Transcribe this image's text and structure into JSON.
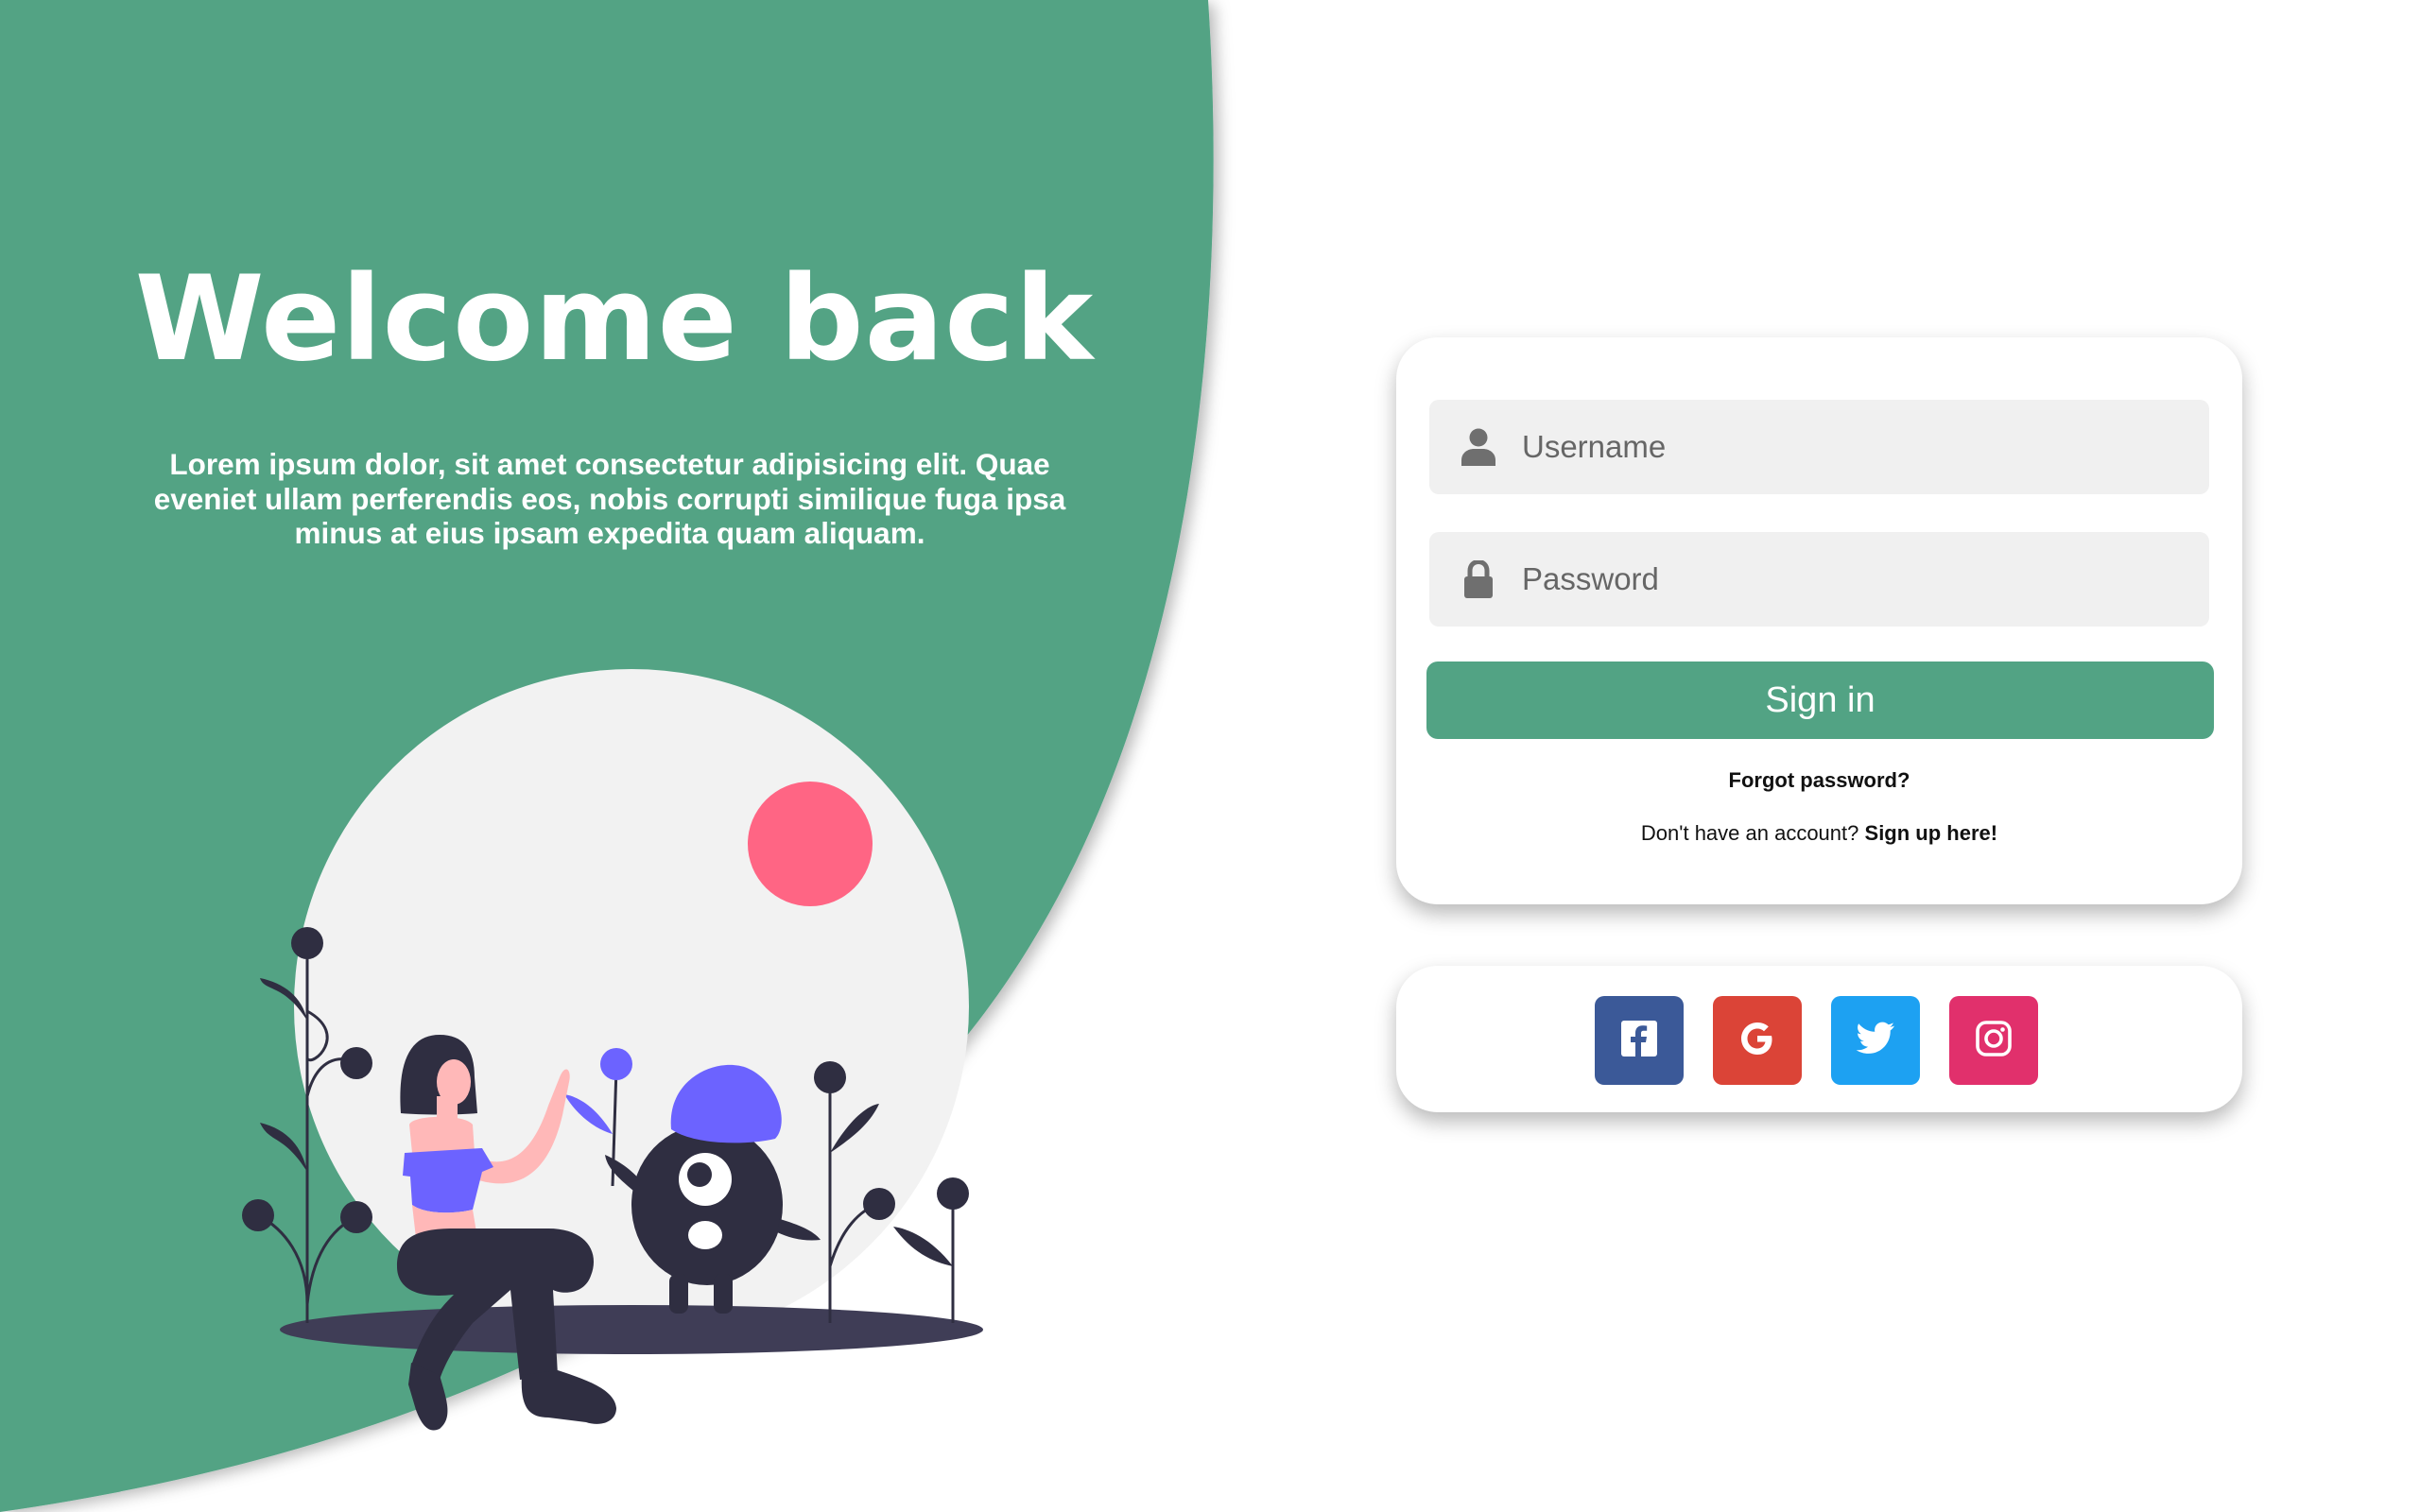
{
  "hero": {
    "title": "Welcome back",
    "text": "Lorem ipsum dolor, sit amet consectetur adipisicing elit. Quae eveniet ullam perferendis eos, nobis corrupti similique fuga ipsa minus at eius ipsam expedita quam aliquam."
  },
  "login": {
    "username_placeholder": "Username",
    "password_placeholder": "Password",
    "username_icon": "user-icon",
    "password_icon": "lock-icon",
    "signin_label": "Sign in",
    "forgot_label": "Forgot password?",
    "no_account_text": "Don't have an account?",
    "signup_label": "Sign up here!"
  },
  "social": {
    "buttons": [
      {
        "name": "facebook",
        "icon": "facebook-icon",
        "color": "#3b5998"
      },
      {
        "name": "google",
        "icon": "google-icon",
        "color": "#db4437"
      },
      {
        "name": "twitter",
        "icon": "twitter-icon",
        "color": "#1da1f2"
      },
      {
        "name": "instagram",
        "icon": "instagram-icon",
        "color": "#e1306c"
      }
    ]
  },
  "colors": {
    "accent": "#52a384",
    "background": "#ffffff",
    "input_bg": "#f0f0f0",
    "illustration_circle": "#f2f2f2",
    "illustration_sun": "#ff6584",
    "illustration_purple": "#6c63ff",
    "illustration_dark": "#2f2e41"
  }
}
